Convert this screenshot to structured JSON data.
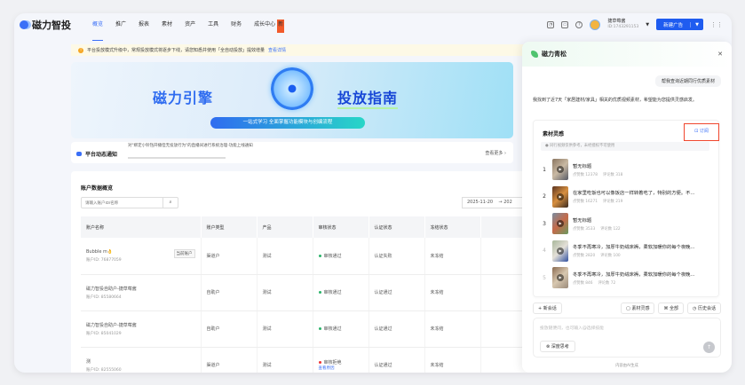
{
  "header": {
    "logo": "磁力智投",
    "nav": [
      "概览",
      "推广",
      "报表",
      "素材",
      "资产",
      "工具",
      "财务",
      "成长中心"
    ],
    "new_badge": "新",
    "user_name": "捷草莓酱",
    "user_id": "ID:1743291153",
    "create_button": "新建广告"
  },
  "notice": {
    "text": "平台投放模式升级中，常规投放模式将逐步下线，请您知悉并使用「全自动投放」提效增量",
    "link": "查看详情"
  },
  "banner": {
    "title_left": "磁力引擎",
    "title_right": "投放指南",
    "subtitle": "一站式学习  全面掌握功能模块与创编流程"
  },
  "platform_notice": {
    "title": "平台动态通知",
    "message": "对\"绑定小铃铛开播但无投放行为\"的直播间进行系统治理-功能上线通知",
    "more": "查看更多 ›"
  },
  "accounts": {
    "title": "账户数据概览",
    "search_placeholder": "请输入账户ID/名称",
    "date_start": "2025-11-20",
    "date_sep": "→ 202",
    "columns": [
      "账户名称",
      "账户类型",
      "产品",
      "审核状态",
      "认证状态",
      "冻结状态"
    ],
    "rows": [
      {
        "name": "Bubble m👌",
        "id": "账户ID: 76877059",
        "tag": "当前账户",
        "type": "渠道户",
        "product": "测试",
        "review": "审核通过",
        "cert": "认证失败",
        "freeze": "未冻结"
      },
      {
        "name": "磁力智投自助户-捷草莓酱",
        "id": "账户ID: 85580664",
        "type": "自助户",
        "product": "测试",
        "review": "审核通过",
        "cert": "认证通过",
        "freeze": "未冻结"
      },
      {
        "name": "磁力智投自助户-捷草莓酱",
        "id": "账户ID: 85041029",
        "type": "自助户",
        "product": "测试",
        "review": "审核通过",
        "cert": "认证通过",
        "freeze": "未冻结"
      },
      {
        "name": "测",
        "id": "账户ID: 82555060",
        "type": "渠道户",
        "product": "测试",
        "review": "审核拒绝",
        "review_link": "查看原因",
        "cert": "认证通过",
        "freeze": "未冻结"
      }
    ]
  },
  "panel": {
    "title": "磁力青松",
    "user_msg": "帮我查询近期同行优质素材",
    "ai_msg": "我找到了近7天「家居建材/家具」相关的优质视频素材，希望能为您提供灵感启发。",
    "card_title": "素材灵感",
    "subscribe": "订阅",
    "hint": "● 同行视频仅供参考，未经授权不可使用",
    "items": [
      {
        "no": "1",
        "title": "暂无标题",
        "likes": "点赞数 12378",
        "comments": "评论数 318"
      },
      {
        "no": "2",
        "title": "在家里吃饭也可以像饭店一样转着吃了，特别的方便。不...",
        "likes": "点赞数 16271",
        "comments": "评论数 219"
      },
      {
        "no": "3",
        "title": "暂无标题",
        "likes": "点赞数 3533",
        "comments": "评论数 122"
      },
      {
        "no": "4",
        "title": "冬季不再寒冷，加厚牛奶绒床褥，柔软加暖你的每个夜晚...",
        "likes": "点赞数 2820",
        "comments": "评论数 100"
      },
      {
        "no": "5",
        "title": "冬季不再寒冷，加厚牛奶绒床褥，柔软加暖你的每个夜晚...",
        "likes": "点赞数 846",
        "comments": "评论数 72"
      }
    ],
    "new_chat": "+ 新会话",
    "btn_material": "▢ 素材灵感",
    "btn_all": "⌘ 全部",
    "btn_history": "◷ 历史会话",
    "input_placeholder": "投放随便问，也可输入@选择技能",
    "deep_think": "⊗ 深度思考",
    "footer": "内容由AI生成"
  }
}
